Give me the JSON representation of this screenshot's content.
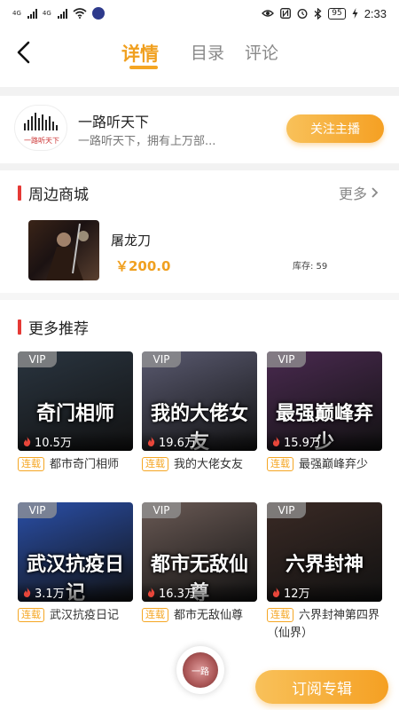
{
  "status_bar": {
    "network_1": "4G",
    "network_2": "4G",
    "battery": "95",
    "time": "2:33",
    "icons": [
      "signal-icon",
      "wifi-icon",
      "app-notification-icon",
      "eye-icon",
      "nfc-icon",
      "alarm-icon",
      "bluetooth-icon",
      "battery-icon",
      "charging-icon"
    ]
  },
  "header": {
    "tabs": [
      {
        "label": "详情",
        "active": true
      },
      {
        "label": "目录",
        "active": false
      },
      {
        "label": "评论",
        "active": false
      }
    ],
    "accent_color": "#f5a623"
  },
  "anchor": {
    "name": "一路听天下",
    "description": "一路听天下，拥有上万部...",
    "logo_text": "一路听天下",
    "follow_label": "关注主播"
  },
  "shop": {
    "title": "周边商城",
    "more_label": "更多",
    "product": {
      "name": "屠龙刀",
      "price": "￥200.0",
      "stock": "库存:  59"
    }
  },
  "recommend": {
    "title": "更多推荐",
    "badge": "VIP",
    "tag": "连载",
    "items": [
      {
        "cover_text": "奇门相师",
        "plays": "10.5万",
        "title": "都市奇门相师",
        "cover_color": "#2a3540"
      },
      {
        "cover_text": "我的大佬女友",
        "plays": "19.6万",
        "title": "我的大佬女友",
        "cover_color": "#5a5a70"
      },
      {
        "cover_text": "最强巅峰弃少",
        "plays": "15.9万",
        "title": "最强巅峰弃少",
        "cover_color": "#4a2a50"
      },
      {
        "cover_text": "武汉抗疫日记",
        "plays": "3.1万",
        "title": "武汉抗疫日记",
        "cover_color": "#2a4fa8"
      },
      {
        "cover_text": "都市无敌仙尊",
        "plays": "16.3万",
        "title": "都市无敌仙尊",
        "cover_color": "#6a5a55"
      },
      {
        "cover_text": "六界封神",
        "plays": "12万",
        "title": "六界封神第四界（仙界）",
        "cover_color": "#3a2a25"
      }
    ]
  },
  "bottom": {
    "subscribe_label": "订阅专辑",
    "player_text": "一路"
  }
}
